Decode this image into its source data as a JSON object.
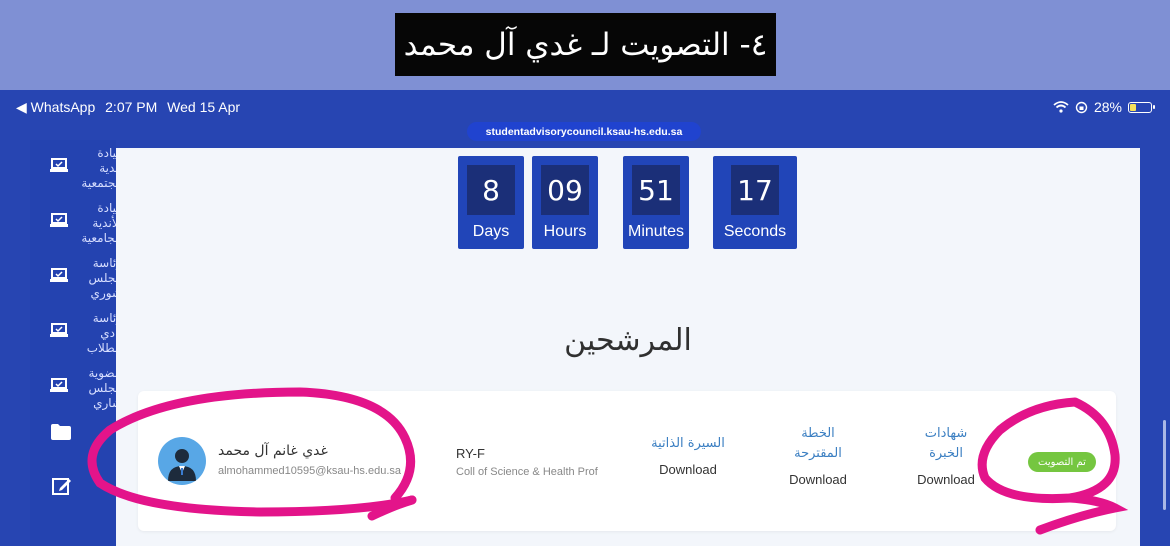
{
  "caption": "٤- التصويت لـ غدي آل محمد",
  "status_bar": {
    "back_app": "◀ WhatsApp",
    "time": "2:07 PM",
    "date": "Wed 15 Apr",
    "battery_text": "28%",
    "battery_level": 0.28
  },
  "url": "studentadvisorycouncil.ksau-hs.edu.sa",
  "sidebar": {
    "items": [
      {
        "label": "قيادة أندية مجتمعية",
        "icon": "laptop-icon"
      },
      {
        "label": "قيادة الأندية الجامعية",
        "icon": "laptop-icon"
      },
      {
        "label": "رئاسة مجلس شوري",
        "icon": "laptop-icon"
      },
      {
        "label": "رئاسة نادي الطلاب",
        "icon": "laptop-icon"
      },
      {
        "label": "عضوية مجلس شاري",
        "icon": "laptop-icon"
      }
    ],
    "folder_icon": "folder-icon",
    "edit_icon": "edit-icon"
  },
  "countdown": [
    {
      "value": "8",
      "label": "Days"
    },
    {
      "value": "09",
      "label": "Hours"
    },
    {
      "value": "51",
      "label": "Minutes"
    },
    {
      "value": "17",
      "label": "Seconds"
    }
  ],
  "heading": "المرشحين",
  "candidate": {
    "name": "غدي غانم آل محمد",
    "email": "almohammed10595@ksau-hs.edu.sa",
    "code": "RY-F",
    "college": "Coll of Science & Health Prof",
    "docs": [
      {
        "title_lines": [
          "السيرة الذاتية"
        ],
        "link": "Download"
      },
      {
        "title_lines": [
          "الخطة",
          "المقترحة"
        ],
        "link": "Download"
      },
      {
        "title_lines": [
          "شهادات",
          "الخبرة"
        ],
        "link": "Download"
      }
    ],
    "status_badge": "تم التصويت"
  },
  "colors": {
    "header_blue": "#2745b2",
    "badge_green": "#75c640",
    "annotation_pink": "#e3148a"
  }
}
